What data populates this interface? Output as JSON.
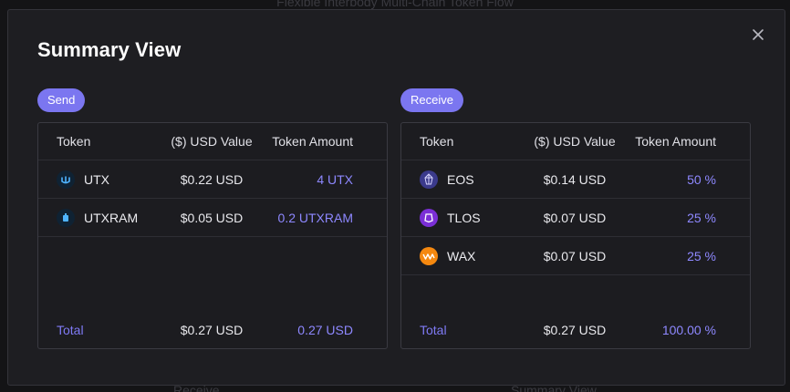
{
  "background": {
    "top_text": "Flexible Interbody Multi-Chain Token Flow",
    "bottom_left_text": "Receive",
    "bottom_right_text": "Summary View"
  },
  "modal": {
    "title": "Summary View",
    "close_icon": "close-icon"
  },
  "send": {
    "label": "Send",
    "headers": {
      "token": "Token",
      "usd": "($) USD Value",
      "amount": "Token Amount"
    },
    "rows": [
      {
        "icon": "utx-icon",
        "token": "UTX",
        "usd": "$0.22 USD",
        "amount": "4 UTX"
      },
      {
        "icon": "utxram-icon",
        "token": "UTXRAM",
        "usd": "$0.05 USD",
        "amount": "0.2 UTXRAM"
      }
    ],
    "total": {
      "label": "Total",
      "usd": "$0.27 USD",
      "amount": "0.27 USD"
    }
  },
  "receive": {
    "label": "Receive",
    "headers": {
      "token": "Token",
      "usd": "($) USD Value",
      "amount": "Token Amount"
    },
    "rows": [
      {
        "icon": "eos-icon",
        "token": "EOS",
        "usd": "$0.14 USD",
        "amount": "50 %"
      },
      {
        "icon": "tlos-icon",
        "token": "TLOS",
        "usd": "$0.07 USD",
        "amount": "25 %"
      },
      {
        "icon": "wax-icon",
        "token": "WAX",
        "usd": "$0.07 USD",
        "amount": "25 %"
      }
    ],
    "total": {
      "label": "Total",
      "usd": "$0.27 USD",
      "amount": "100.00 %"
    }
  },
  "colors": {
    "accent": "#7b76f0",
    "amount_text": "#8e88ff",
    "modal_bg": "#1e1e22",
    "page_bg": "#141416"
  }
}
